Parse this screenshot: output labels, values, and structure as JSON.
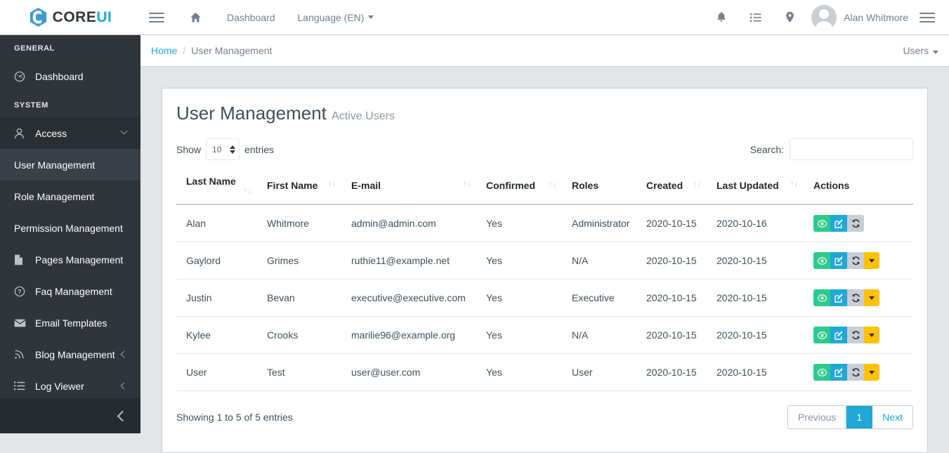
{
  "header": {
    "brand": {
      "core": "CORE",
      "ui": "UI"
    },
    "nav_left": [
      {
        "name": "home",
        "icon": "home-icon",
        "label": ""
      },
      {
        "name": "dashboard",
        "label": "Dashboard"
      },
      {
        "name": "language",
        "label": "Language (EN)",
        "caret": true
      }
    ],
    "nav_right_icons": [
      "bell-icon",
      "task-list-icon",
      "location-pin-icon"
    ],
    "user_name": "Alan Whitmore"
  },
  "sidebar": {
    "groups": [
      {
        "title": "GENERAL",
        "items": [
          {
            "label": "Dashboard",
            "icon": "speedometer-icon"
          }
        ]
      },
      {
        "title": "SYSTEM",
        "items": [
          {
            "label": "Access",
            "icon": "user-icon",
            "state": "open",
            "chevron": "down"
          },
          {
            "label": "User Management",
            "type": "sub",
            "state": "highlight"
          },
          {
            "label": "Role Management",
            "type": "sub"
          },
          {
            "label": "Permission Management",
            "type": "sub"
          },
          {
            "label": "Pages Management",
            "icon": "file-icon"
          },
          {
            "label": "Faq Management",
            "icon": "question-circle-icon"
          },
          {
            "label": "Email Templates",
            "icon": "envelope-icon"
          },
          {
            "label": "Blog Management",
            "icon": "rss-icon",
            "chevron": "left"
          },
          {
            "label": "Log Viewer",
            "icon": "list-icon",
            "chevron": "left"
          }
        ]
      }
    ]
  },
  "breadcrumb": {
    "home": "Home",
    "separator": "/",
    "current": "User Management",
    "menu": "Users"
  },
  "card": {
    "title": "User Management",
    "subtitle": "Active Users",
    "show_label": "Show",
    "entries_label": "entries",
    "page_length": "10",
    "search_label": "Search:",
    "search_value": "",
    "search_placeholder": "",
    "columns": [
      {
        "label": "Last Name",
        "sortable": true
      },
      {
        "label": "First Name",
        "sortable": true
      },
      {
        "label": "E-mail",
        "sortable": true
      },
      {
        "label": "Confirmed",
        "sortable": true
      },
      {
        "label": "Roles",
        "sortable": false
      },
      {
        "label": "Created",
        "sortable": true
      },
      {
        "label": "Last Updated",
        "sortable": true
      },
      {
        "label": "Actions",
        "sortable": false
      }
    ],
    "rows": [
      {
        "last_name": "Alan",
        "first_name": "Whitmore",
        "email": "admin@admin.com",
        "confirmed": "Yes",
        "roles": "Administrator",
        "created": "2020-10-15",
        "updated": "2020-10-16",
        "has_more": false
      },
      {
        "last_name": "Gaylord",
        "first_name": "Grimes",
        "email": "ruthie11@example.net",
        "confirmed": "Yes",
        "roles": "N/A",
        "created": "2020-10-15",
        "updated": "2020-10-15",
        "has_more": true
      },
      {
        "last_name": "Justin",
        "first_name": "Bevan",
        "email": "executive@executive.com",
        "confirmed": "Yes",
        "roles": "Executive",
        "created": "2020-10-15",
        "updated": "2020-10-15",
        "has_more": true
      },
      {
        "last_name": "Kylee",
        "first_name": "Crooks",
        "email": "marilie96@example.org",
        "confirmed": "Yes",
        "roles": "N/A",
        "created": "2020-10-15",
        "updated": "2020-10-15",
        "has_more": true
      },
      {
        "last_name": "User",
        "first_name": "Test",
        "email": "user@user.com",
        "confirmed": "Yes",
        "roles": "User",
        "created": "2020-10-15",
        "updated": "2020-10-15",
        "has_more": true
      }
    ],
    "action_buttons": [
      {
        "name": "view-button",
        "icon": "eye-icon",
        "color": "#2eca8b"
      },
      {
        "name": "edit-button",
        "icon": "pencil-square-icon",
        "color": "#20a8d8"
      },
      {
        "name": "restore-button",
        "icon": "refresh-icon",
        "color": "#c8ced3"
      },
      {
        "name": "more-actions-button",
        "icon": "caret-down-icon",
        "color": "#ffc107"
      }
    ],
    "showing_info": "Showing 1 to 5 of 5 entries",
    "pagination": {
      "previous": "Previous",
      "pages": [
        "1"
      ],
      "next": "Next",
      "current": "1"
    }
  },
  "colors": {
    "accent": "#20a8d8",
    "sidebar_bg": "#2f353a",
    "success": "#2eca8b",
    "warning": "#ffc107",
    "secondary": "#c8ced3"
  }
}
